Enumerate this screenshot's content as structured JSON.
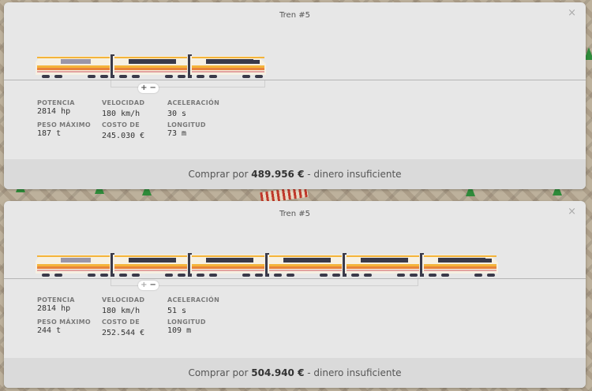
{
  "colors": {
    "panel_bg": "#e7e7e7",
    "footer_bg": "#dadada",
    "train_yellow": "#f4b43a",
    "train_orange": "#e8833a",
    "train_cream": "#f6f0e2",
    "train_dark": "#3a3a4a",
    "tree_green": "#2f8a3a",
    "track_red": "#c0392b"
  },
  "icons": {
    "close": "close-icon",
    "zoom_in": "plus-icon",
    "zoom_out": "minus-icon"
  },
  "panels": [
    {
      "title": "Tren #5",
      "close": "×",
      "zoom_in": "+",
      "zoom_out": "−",
      "cars": 3,
      "stats": {
        "potencia_label": "POTENCIA",
        "potencia": "2814 hp",
        "peso_label": "PESO MÁXIMO",
        "peso": "187 t",
        "velocidad_label": "VELOCIDAD",
        "velocidad": "180 km/h",
        "costo_label": "COSTO DE",
        "costo": "245.030 €",
        "aceleracion_label": "ACELERACIÓN",
        "aceleracion": "30 s",
        "longitud_label": "LONGITUD",
        "longitud": "73 m"
      },
      "buy": {
        "prefix": "Comprar por",
        "price": "489.956 €",
        "suffix": "- dinero insuficiente"
      }
    },
    {
      "title": "Tren #5",
      "close": "×",
      "zoom_in": "+",
      "zoom_out": "−",
      "cars": 6,
      "stats": {
        "potencia_label": "POTENCIA",
        "potencia": "2814 hp",
        "peso_label": "PESO MÁXIMO",
        "peso": "244 t",
        "velocidad_label": "VELOCIDAD",
        "velocidad": "180 km/h",
        "costo_label": "COSTO DE",
        "costo": "252.544 €",
        "aceleracion_label": "ACELERACIÓN",
        "aceleracion": "51 s",
        "longitud_label": "LONGITUD",
        "longitud": "109 m"
      },
      "buy": {
        "prefix": "Comprar por",
        "price": "504.940 €",
        "suffix": "- dinero insuficiente"
      }
    }
  ]
}
